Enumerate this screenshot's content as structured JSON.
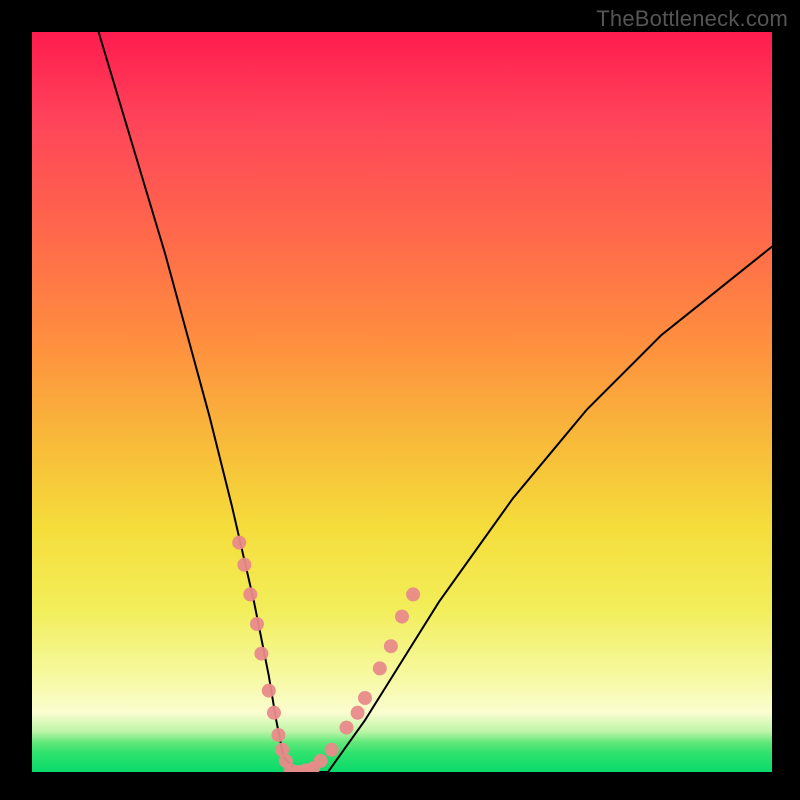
{
  "watermark": "TheBottleneck.com",
  "chart_data": {
    "type": "line",
    "title": "",
    "xlabel": "",
    "ylabel": "",
    "xlim": [
      0,
      100
    ],
    "ylim": [
      0,
      100
    ],
    "grid": false,
    "legend": false,
    "gradient": {
      "top_color": "#ff1c4e",
      "mid_color": "#f5dd3b",
      "bottom_color": "#0ada6a"
    },
    "series": [
      {
        "name": "curve",
        "color": "#000000",
        "width": 2,
        "x": [
          9,
          12,
          15,
          18,
          21,
          24,
          27,
          30,
          32,
          33,
          34,
          36,
          40,
          45,
          50,
          55,
          60,
          65,
          70,
          75,
          80,
          85,
          90,
          95,
          100
        ],
        "values": [
          100,
          90,
          80,
          70,
          59,
          48,
          36,
          23,
          13,
          7,
          2,
          0,
          0,
          7,
          15,
          23,
          30,
          37,
          43,
          49,
          54,
          59,
          63,
          67,
          71
        ]
      },
      {
        "name": "dots-left",
        "color": "#e98a8a",
        "marker": "circle",
        "radius": 7,
        "x": [
          28,
          28.7,
          29.5,
          30.4,
          31,
          32,
          32.7,
          33.3,
          33.8,
          34.3
        ],
        "values": [
          31,
          28,
          24,
          20,
          16,
          11,
          8,
          5,
          3,
          1.5
        ]
      },
      {
        "name": "dots-right",
        "color": "#e98a8a",
        "marker": "circle",
        "radius": 7,
        "x": [
          38,
          39,
          40.5,
          42.5,
          44,
          45,
          47,
          48.5,
          50,
          51.5
        ],
        "values": [
          0.5,
          1.5,
          3,
          6,
          8,
          10,
          14,
          17,
          21,
          24
        ]
      },
      {
        "name": "dots-bottom",
        "color": "#e98a8a",
        "marker": "circle",
        "radius": 7,
        "x": [
          35,
          36,
          37
        ],
        "values": [
          0.2,
          0,
          0.2
        ]
      }
    ]
  }
}
